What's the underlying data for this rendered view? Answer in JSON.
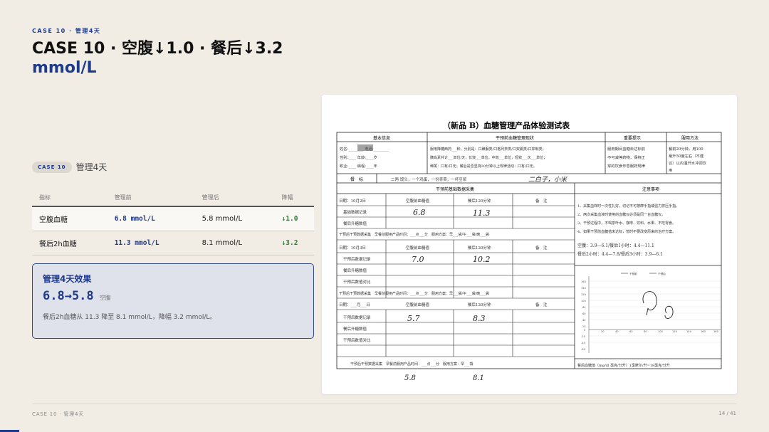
{
  "header": {
    "eyebrow": "CASE 10 · 管理4天",
    "title": "CASE 10 · 空腹↓1.0 · 餐后↓3.2",
    "unit": "mmol/L"
  },
  "case": {
    "chip": "CASE 10",
    "label": "管理4天"
  },
  "table": {
    "headers": [
      "指标",
      "管理前",
      "管理后",
      "降幅"
    ],
    "rows": [
      {
        "name": "空腹血糖",
        "before": "6.8 mmol/L",
        "after": "5.8 mmol/L",
        "drop": "↓1.0"
      },
      {
        "name": "餐后2h血糖",
        "before": "11.3 mmol/L",
        "after": "8.1 mmol/L",
        "drop": "↓3.2"
      }
    ]
  },
  "effect": {
    "heading": "管理4天效果",
    "value": "6.8→5.8",
    "value_label": "空腹",
    "note": "餐后2h血糖从 11.3 降至 8.1 mmol/L，降幅 3.2 mmol/L。"
  },
  "footer": {
    "left": "CASE 10 · 管理4天",
    "right": "14 / 41"
  },
  "document": {
    "title": "（新品 B）血糖管理产品体验测试表",
    "sections": {
      "basic": "基本信息",
      "pre_status": "干预前血糖管理现状",
      "tips": "重要提示",
      "usage": "服用方法",
      "baseline": "干预前基础数据采集",
      "notes": "注意事项"
    },
    "basic_lines": [
      "姓名:________ 电话:________",
      "性别:____ 年龄:____岁",
      "职业:____ 病程:____年"
    ],
    "pre_status_lines": [
      "服用降糖西药___种，分别是：口磺脲类/口格列奈类/口双胍类/口抑制类；",
      "胰岛素共计___单位/天，长效___单位，中效___单位，短效___次___单位；",
      "稀粥：口有/口无；餐后是否坚持30分钟以上规律活动：口有/口无。"
    ],
    "tips_lines": [
      "服用期间血糖未达标前",
      "不可减停药物，保持正",
      "常的饮食作息服药规律"
    ],
    "usage_lines": [
      "餐前20分钟，用100",
      "毫升50度左右（不建",
      "议）以内温开水冲调饮",
      "用"
    ],
    "meal_row": {
      "label": "餐　标",
      "text": "二两 馒头，一个鸡蛋，一份青菜，一杯豆浆",
      "handwriting": "二白子，小米"
    },
    "blocks": [
      {
        "date": "日期：10月2日",
        "fasting_label": "空腹前血糖值",
        "post_label": "餐后120分钟",
        "remark": "备　注",
        "rows": [
          "基础数据记录",
          "餐后升糖数值"
        ],
        "fasting_value": "6.8",
        "post_value": "11.3"
      },
      {
        "date": "日期：10月3日",
        "fasting_label": "空腹前血糖值",
        "post_label": "餐后120分钟",
        "remark": "备　注",
        "rows": [
          "干预后数据记录",
          "餐后升糖数值",
          "干预后数值对比"
        ],
        "fasting_value": "7.0",
        "post_value": "10.2"
      },
      {
        "date": "日期：___月___日",
        "fasting_label": "空腹前血糖值",
        "post_label": "餐后120分钟",
        "remark": "备　注",
        "rows": [
          "干预后数据记录",
          "餐后升糖数值",
          "干预后数值对比"
        ],
        "fasting_value": "5.7",
        "post_value": "8.3"
      }
    ],
    "collect_row": "干预后干预数据采集　早餐前服用产品时间：___点___分　服用方案：早___袋/午___袋/晚___袋",
    "last_collect_row": "干预后干预数据采集　早餐前服用产品时间：___点___分　服用方案：早___袋",
    "notes_lines": [
      "1、采集血样时一次性扎好，切记不可按摩手指或强力挤压手指。",
      "2、两次采集血液时使用的血糖仪必须是同一台血糖仪。",
      "3、干预过程中，不喝茶叶水、咖啡、饮料、水果、不吃零食。",
      "4、如果干预前血糖值未达标，暂时不要改变原来的治疗方案。",
      "空腹：3.9—6.1/餐后1小时：4.4—11.1",
      "餐后2小时：4.4—7.8/餐后3小时：3.9—6.1"
    ],
    "chart_caption": "餐后血糖值（mg/dl 毫克/分升）1毫摩尔/升=18毫克/分升",
    "chart_legend": [
      "干预前",
      "干预后"
    ],
    "handwritten_bottom": [
      "5.8",
      "8.1"
    ],
    "x_ticks": [
      "20",
      "40",
      "60",
      "80",
      "100",
      "120",
      "140",
      "160",
      "180"
    ],
    "y_ticks": [
      "160",
      "140",
      "120",
      "100",
      "80",
      "60",
      "40",
      "20",
      "0",
      "-20",
      "-40",
      "-60"
    ]
  }
}
